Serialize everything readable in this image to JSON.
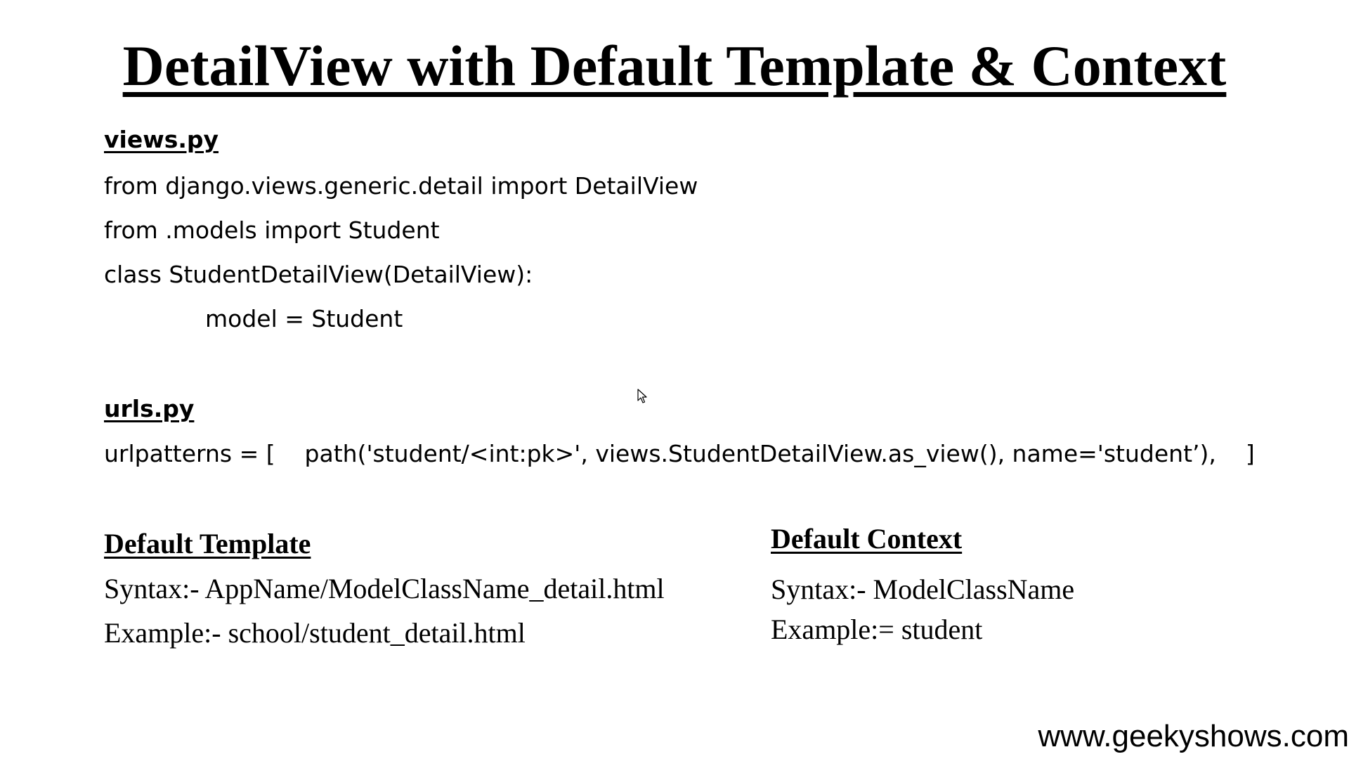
{
  "title": "DetailView with Default Template & Context",
  "views": {
    "heading": "views.py",
    "lines": [
      "from django.views.generic.detail import DetailView",
      "from .models import Student",
      "class StudentDetailView(DetailView):",
      "model = Student"
    ]
  },
  "urls": {
    "heading": "urls.py",
    "line": "urlpatterns = [    path('student/<int:pk>', views.StudentDetailView.as_view(), name='student’),    ]"
  },
  "default_template": {
    "heading": "Default Template",
    "syntax": "Syntax:- AppName/ModelClassName_detail.html",
    "example": "Example:- school/student_detail.html"
  },
  "default_context": {
    "heading": "Default Context",
    "syntax": "Syntax:- ModelClassName",
    "example": "Example:= student"
  },
  "footer": {
    "url": "www.geekyshows.com"
  }
}
